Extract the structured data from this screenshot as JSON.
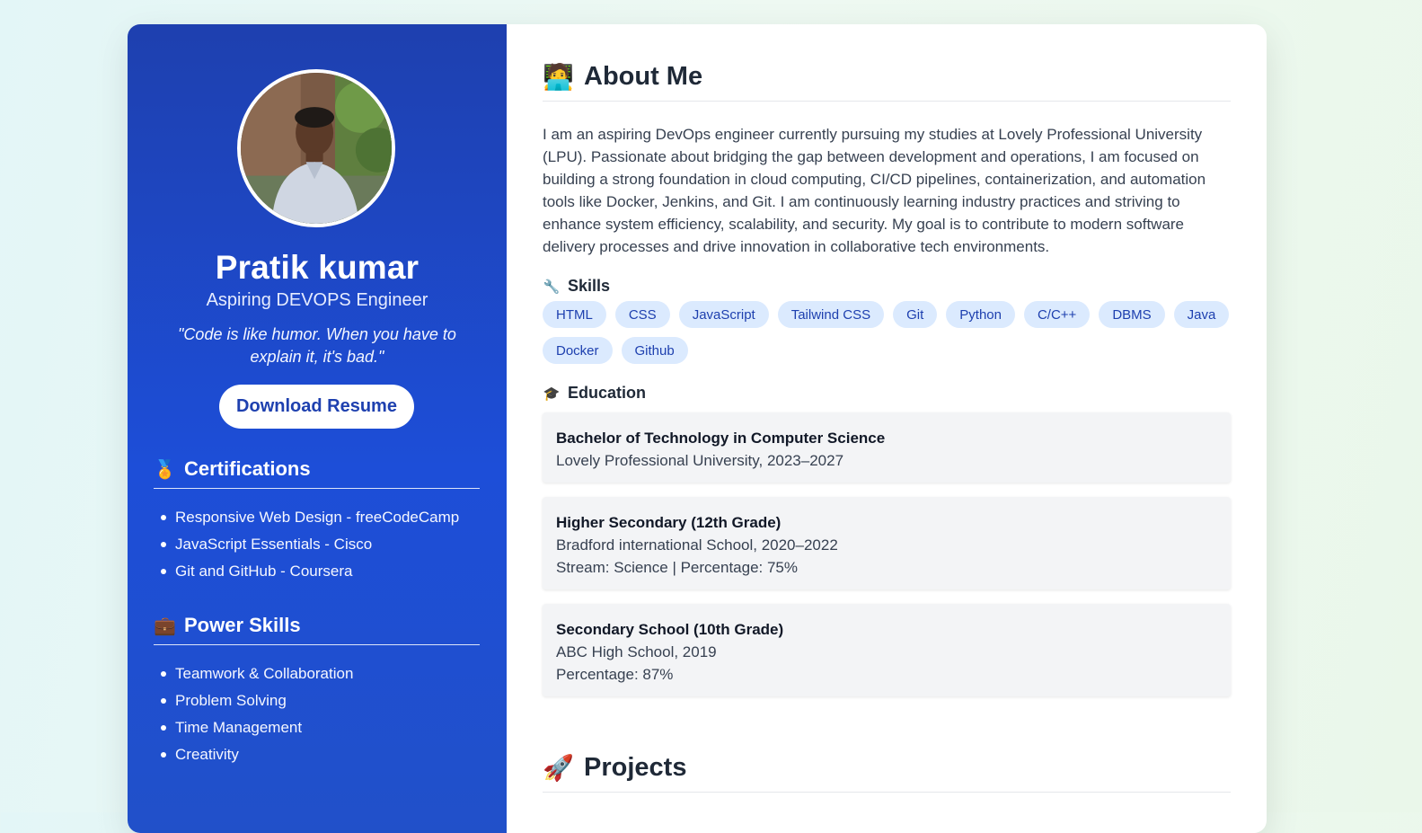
{
  "sidebar": {
    "name": "Pratik kumar",
    "role": "Aspiring DEVOPS Engineer",
    "quote": "\"Code is like humor. When you have to explain it, it's bad.\"",
    "download_label": "Download Resume",
    "certifications": {
      "icon": "medal-icon",
      "emoji": "🏅",
      "title": "Certifications",
      "items": [
        "Responsive Web Design - freeCodeCamp",
        "JavaScript Essentials - Cisco",
        "Git and GitHub - Coursera"
      ]
    },
    "power_skills": {
      "icon": "briefcase-icon",
      "emoji": "💼",
      "title": "Power Skills",
      "items": [
        "Teamwork & Collaboration",
        "Problem Solving",
        "Time Management",
        "Creativity"
      ]
    }
  },
  "main": {
    "about": {
      "icon": "technologist-icon",
      "emoji": "🧑‍💻",
      "title": "About Me",
      "text": "I am an aspiring DevOps engineer currently pursuing my studies at Lovely Professional University (LPU). Passionate about bridging the gap between development and operations, I am focused on building a strong foundation in cloud computing, CI/CD pipelines, containerization, and automation tools like Docker, Jenkins, and Git. I am continuously learning industry practices and striving to enhance system efficiency, scalability, and security. My goal is to contribute to modern software delivery processes and drive innovation in collaborative tech environments."
    },
    "skills": {
      "icon": "wrench-icon",
      "emoji": "🔧",
      "title": "Skills",
      "chips": [
        "HTML",
        "CSS",
        "JavaScript",
        "Tailwind CSS",
        "Git",
        "Python",
        "C/C++",
        "DBMS",
        "Java",
        "Docker",
        "Github"
      ]
    },
    "education": {
      "icon": "graduation-cap-icon",
      "emoji": "🎓",
      "title": "Education",
      "entries": [
        {
          "degree": "Bachelor of Technology in Computer Science",
          "line1": "Lovely Professional University, 2023–2027",
          "line2": ""
        },
        {
          "degree": "Higher Secondary (12th Grade)",
          "line1": "Bradford international School, 2020–2022",
          "line2": "Stream: Science | Percentage: 75%"
        },
        {
          "degree": "Secondary School (10th Grade)",
          "line1": "ABC High School, 2019",
          "line2": "Percentage: 87%"
        }
      ]
    },
    "projects": {
      "icon": "rocket-icon",
      "emoji": "🚀",
      "title": "Projects"
    }
  },
  "colors": {
    "sidebar_top": "#1e40af",
    "sidebar_bottom": "#2150c9",
    "chip_bg": "#dbeafe",
    "chip_text": "#1e40af",
    "edu_card_bg": "#f3f4f6"
  }
}
